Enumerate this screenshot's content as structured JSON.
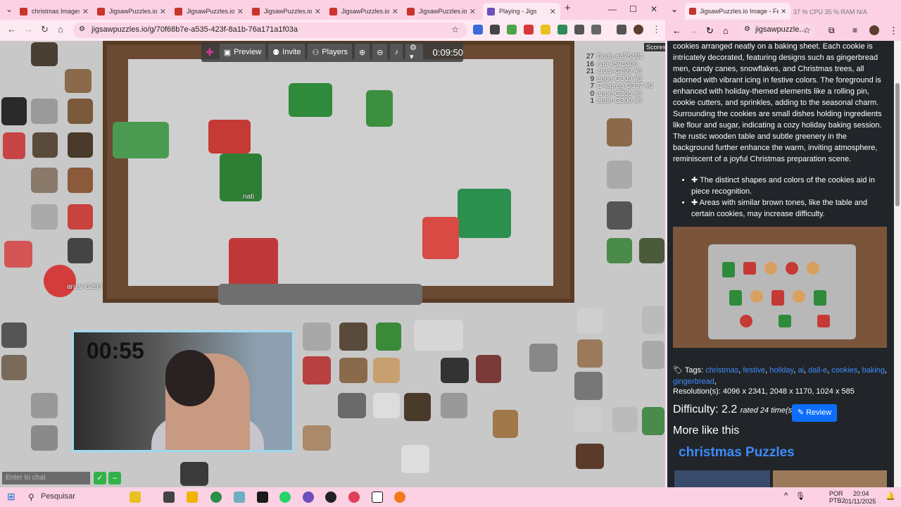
{
  "browser_left": {
    "tabs": [
      {
        "label": "christmas Images",
        "fav": "#c9342b"
      },
      {
        "label": "JigsawPuzzles.io",
        "fav": "#c9342b"
      },
      {
        "label": "JigsawPuzzles.io",
        "fav": "#c9342b"
      },
      {
        "label": "JigsawPuzzles.io",
        "fav": "#c9342b"
      },
      {
        "label": "JigsawPuzzles.io",
        "fav": "#c9342b"
      },
      {
        "label": "JigsawPuzzles.io",
        "fav": "#c9342b"
      },
      {
        "label": "Playing - Jigs",
        "fav": "#6b4fbb"
      }
    ],
    "url": "jigsawpuzzles.io/g/70f68b7e-a535-423f-8a1b-76a171a1f03a"
  },
  "game": {
    "toolbar": {
      "preview": "Preview",
      "invite": "Invite",
      "players": "Players",
      "timer": "0:09:50"
    },
    "scores_tab": "Scores",
    "scores": [
      {
        "n": "27",
        "user": "Duda #475401"
      },
      {
        "n": "16",
        "user": "nati #575400"
      },
      {
        "n": "21",
        "user": "arual-G299 #0"
      },
      {
        "n": "9",
        "user": "anon-G309 #0"
      },
      {
        "n": "7",
        "user": "C-legreg G307 #0"
      },
      {
        "n": "0",
        "user": "anon-G305 #0"
      },
      {
        "n": "1",
        "user": "anon-G306 #0"
      }
    ],
    "player_tags": {
      "nati": "nati",
      "arual": "arual-G299"
    },
    "webcam_clock": "00:55",
    "chat_placeholder": "Enter to chat"
  },
  "right_window": {
    "tab_label": "JigsawPuzzles.io Image - Festiv",
    "cpu_stats": "37 %  CPU 35 %  RAM N/A",
    "url": "jigsawpuzzle...",
    "description": "cookies arranged neatly on a baking sheet. Each cookie is intricately decorated, featuring designs such as gingerbread men, candy canes, snowflakes, and Christmas trees, all adorned with vibrant icing in festive colors. The foreground is enhanced with holiday-themed elements like a rolling pin, cookie cutters, and sprinkles, adding to the seasonal charm. Surrounding the cookies are small dishes holding ingredients like flour and sugar, indicating a cozy holiday baking session. The rustic wooden table and subtle greenery in the background further enhance the warm, inviting atmosphere, reminiscent of a joyful Christmas preparation scene.",
    "bullets": [
      "The distinct shapes and colors of the cookies aid in piece recognition.",
      "Areas with similar brown tones, like the table and certain cookies, may increase difficulty."
    ],
    "tags_label": "Tags:",
    "tags": [
      "christmas",
      "festive",
      "holiday",
      "ai",
      "dall-e",
      "cookies",
      "baking",
      "gingerbread"
    ],
    "resolution": "Resolution(s): 4096 x 2341, 2048 x 1170, 1024 x 585",
    "difficulty": "Difficulty: 2.2",
    "rated": "rated 24 time(s)",
    "review": "Review",
    "more_like": "More like this",
    "more_link": "christmas Puzzles"
  },
  "taskbar": {
    "search": "Pesquisar",
    "lang": "POR\nPTB2",
    "time": "20:04",
    "date": "01/11/2025"
  },
  "colors": {
    "link": "#3d8bfd",
    "review_button": "#0d6efd",
    "chat_send": "#33b249",
    "chrome_pink": "#fbd1e3"
  }
}
